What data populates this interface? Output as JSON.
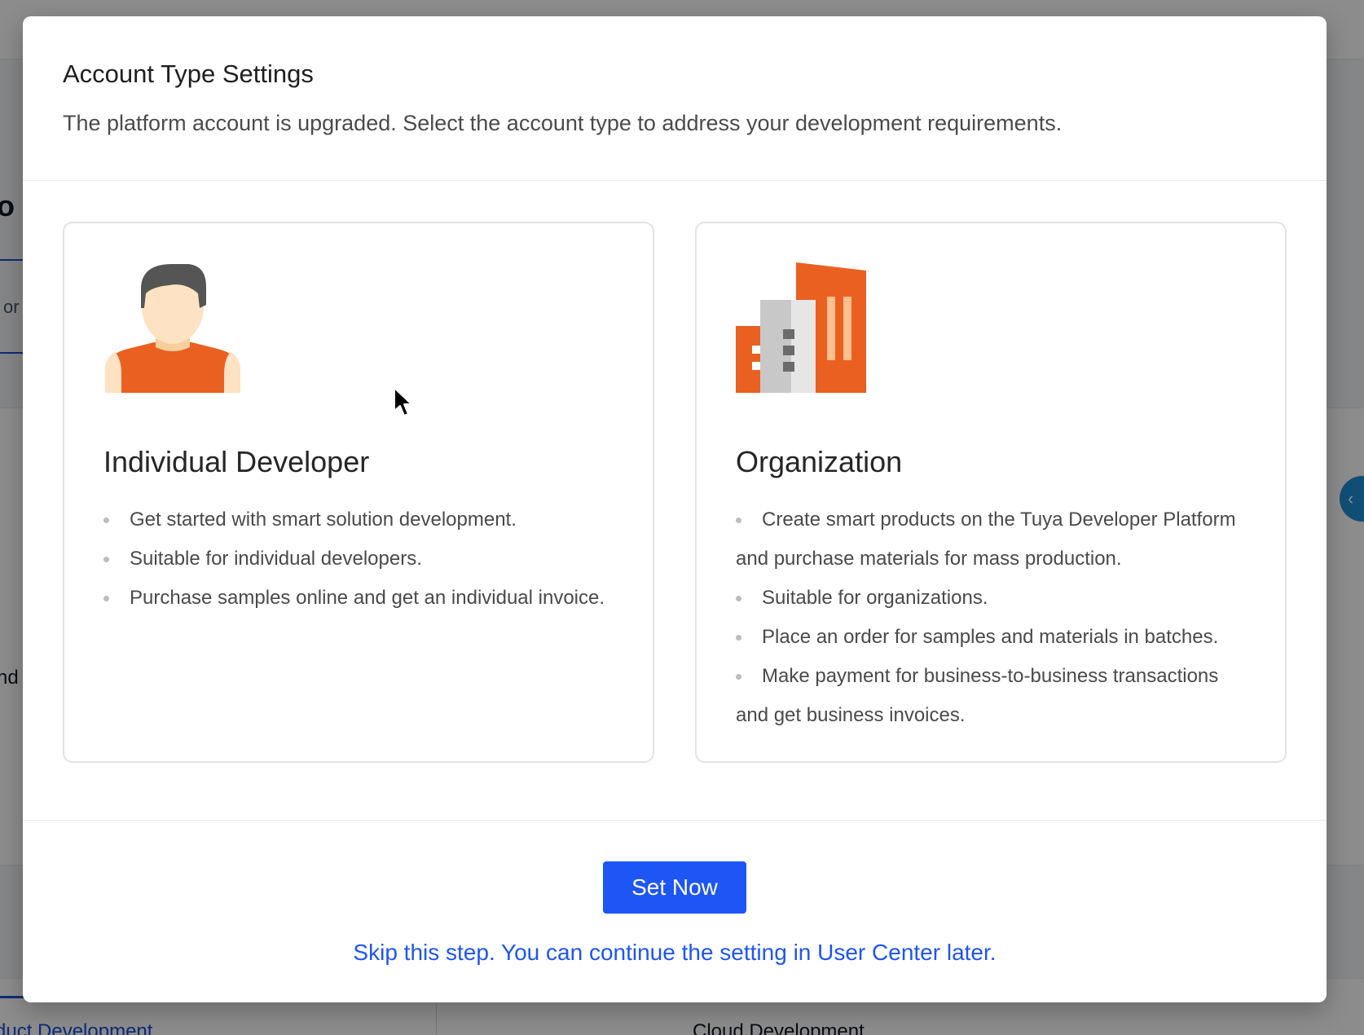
{
  "background": {
    "heading_fragment": "o",
    "subtab_fragment": "or",
    "panel_text_fragment": "nd",
    "circle_button_glyph": "‹",
    "bottom_tabs": [
      "duct Development",
      "Cloud Development"
    ]
  },
  "modal": {
    "title": "Account Type Settings",
    "description": "The platform account is upgraded. Select the account type to address your development requirements.",
    "cards": [
      {
        "title": "Individual Developer",
        "icon": "person-icon",
        "bullets": [
          "Get started with smart solution development.",
          "Suitable for individual developers.",
          "Purchase samples online and get an individual invoice."
        ]
      },
      {
        "title": "Organization",
        "icon": "building-icon",
        "bullets": [
          "Create smart products on the Tuya Developer Platform and purchase materials for mass production.",
          "Suitable for organizations.",
          "Place an order for samples and materials in batches.",
          "Make payment for business-to-business transactions and get business invoices."
        ]
      }
    ],
    "primary_button_label": "Set Now",
    "skip_link_text": "Skip this step. You can continue the setting in User Center later."
  },
  "colors": {
    "primary": "#1e55f5",
    "illustration_orange": "#ea6021",
    "overlay": "rgba(0,0,0,0.45)"
  }
}
